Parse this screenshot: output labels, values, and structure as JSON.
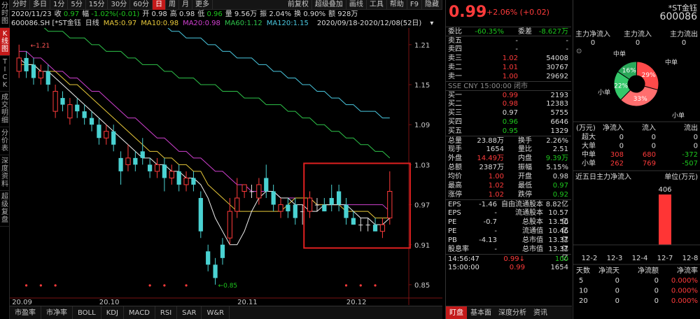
{
  "left_tabs": [
    "分时图",
    "K线图",
    "TICK",
    "成交明细",
    "分价表",
    "深度资料",
    "超级复盘"
  ],
  "toolbar": {
    "items": [
      "分时",
      "多日",
      "1分",
      "5分",
      "15分",
      "30分",
      "60分",
      "日",
      "周",
      "月",
      "更多"
    ],
    "active": "日",
    "right_items": [
      "前复权",
      "超级叠加",
      "画线",
      "工具",
      "帮助",
      "F9",
      "隐藏"
    ]
  },
  "infobar": {
    "date": "2020/11/23",
    "items": [
      {
        "label": "收",
        "value": "0.97",
        "color": "#1ec81e"
      },
      {
        "label": "幅",
        "value": "-1.02%(-0.01)",
        "color": "#1ec81e"
      },
      {
        "label": "开",
        "value": "0.98",
        "color": "#dcdcdc"
      },
      {
        "label": "高",
        "value": "0.98",
        "color": "#dcdcdc"
      },
      {
        "label": "低",
        "value": "0.96",
        "color": "#1ec81e"
      },
      {
        "label": "量",
        "value": "9.56万",
        "color": "#dcdcdc"
      },
      {
        "label": "振",
        "value": "2.04%",
        "color": "#dcdcdc"
      },
      {
        "label": "换",
        "value": "0.90%",
        "color": "#dcdcdc"
      },
      {
        "label": "额",
        "value": "928万",
        "color": "#dcdcdc"
      }
    ]
  },
  "mabar": {
    "symbol": "600086.SH [*ST金钰",
    "items": [
      {
        "text": "日线",
        "color": "#e0e0e0"
      },
      {
        "text": "MA5:0.97",
        "color": "#e8c93a"
      },
      {
        "text": "MA10:0.98",
        "color": "#e8c93a"
      },
      {
        "text": "MA20:0.98",
        "color": "#d040d0"
      },
      {
        "text": "MA60:1.12",
        "color": "#2ec44a"
      },
      {
        "text": "MA120:1.15",
        "color": "#4ac8e0"
      }
    ],
    "range": "2020/09/18-2020/12/08(52日)"
  },
  "chart_data": {
    "type": "candlestick",
    "y_ticks": [
      "1.21",
      "1.15",
      "1.09",
      "1.03",
      "0.97",
      "0.91",
      "0.85"
    ],
    "x_ticks": [
      "20.09",
      "20.10",
      "20.11",
      "20.12"
    ],
    "ylim": [
      0.83,
      1.235
    ],
    "high_label": "1.21",
    "low_label": "0.85",
    "candles": [
      {
        "o": 1.17,
        "c": 1.19,
        "h": 1.21,
        "l": 1.16
      },
      {
        "o": 1.19,
        "c": 1.17,
        "h": 1.2,
        "l": 1.16
      },
      {
        "o": 1.18,
        "c": 1.16,
        "h": 1.19,
        "l": 1.15
      },
      {
        "o": 1.16,
        "c": 1.17,
        "h": 1.18,
        "l": 1.15
      },
      {
        "o": 1.17,
        "c": 1.15,
        "h": 1.18,
        "l": 1.14
      },
      {
        "o": 1.11,
        "c": 1.14,
        "h": 1.15,
        "l": 1.1
      },
      {
        "o": 1.13,
        "c": 1.12,
        "h": 1.14,
        "l": 1.11
      },
      {
        "o": 1.1,
        "c": 1.12,
        "h": 1.13,
        "l": 1.09
      },
      {
        "o": 1.12,
        "c": 1.11,
        "h": 1.13,
        "l": 1.1
      },
      {
        "o": 1.11,
        "c": 1.1,
        "h": 1.12,
        "l": 1.09
      },
      {
        "o": 1.1,
        "c": 1.09,
        "h": 1.11,
        "l": 1.08
      },
      {
        "o": 1.09,
        "c": 1.07,
        "h": 1.1,
        "l": 1.06
      },
      {
        "o": 1.07,
        "c": 1.08,
        "h": 1.09,
        "l": 1.06
      },
      {
        "o": 1.08,
        "c": 1.06,
        "h": 1.09,
        "l": 1.05
      },
      {
        "o": 1.04,
        "c": 1.02,
        "h": 1.05,
        "l": 1.0
      },
      {
        "o": 1.03,
        "c": 1.04,
        "h": 1.06,
        "l": 1.02
      },
      {
        "o": 1.04,
        "c": 1.03,
        "h": 1.05,
        "l": 1.02
      },
      {
        "o": 1.05,
        "c": 1.04,
        "h": 1.07,
        "l": 1.03
      },
      {
        "o": 1.03,
        "c": 1.02,
        "h": 1.04,
        "l": 1.01
      },
      {
        "o": 1.02,
        "c": 1.03,
        "h": 1.04,
        "l": 1.01
      },
      {
        "o": 1.03,
        "c": 1.01,
        "h": 1.04,
        "l": 0.99
      },
      {
        "o": 1.01,
        "c": 1.02,
        "h": 1.03,
        "l": 1.0
      },
      {
        "o": 1.02,
        "c": 1.0,
        "h": 1.03,
        "l": 0.99
      },
      {
        "o": 1.0,
        "c": 1.01,
        "h": 1.02,
        "l": 0.99
      },
      {
        "o": 1.01,
        "c": 1.0,
        "h": 1.02,
        "l": 0.99
      },
      {
        "o": 0.98,
        "c": 0.93,
        "h": 0.99,
        "l": 0.92
      },
      {
        "o": 0.9,
        "c": 0.88,
        "h": 0.91,
        "l": 0.87
      },
      {
        "o": 0.88,
        "c": 0.86,
        "h": 0.89,
        "l": 0.85
      },
      {
        "o": 0.91,
        "c": 0.89,
        "h": 0.92,
        "l": 0.88
      },
      {
        "o": 0.92,
        "c": 0.96,
        "h": 0.98,
        "l": 0.91
      },
      {
        "o": 0.96,
        "c": 0.98,
        "h": 1.01,
        "l": 0.95
      },
      {
        "o": 0.99,
        "c": 1.0,
        "h": 1.0,
        "l": 0.98
      },
      {
        "o": 0.99,
        "c": 0.99,
        "h": 1.0,
        "l": 0.98
      },
      {
        "o": 0.98,
        "c": 1.0,
        "h": 1.01,
        "l": 0.97
      },
      {
        "o": 1.01,
        "c": 0.99,
        "h": 1.03,
        "l": 0.98
      },
      {
        "o": 0.99,
        "c": 0.97,
        "h": 1.0,
        "l": 0.96
      },
      {
        "o": 0.96,
        "c": 0.97,
        "h": 0.98,
        "l": 0.95
      },
      {
        "o": 0.97,
        "c": 0.96,
        "h": 0.98,
        "l": 0.95
      },
      {
        "o": 0.97,
        "c": 0.95,
        "h": 0.98,
        "l": 0.94
      },
      {
        "o": 0.96,
        "c": 0.96,
        "h": 0.97,
        "l": 0.94
      },
      {
        "o": 0.96,
        "c": 0.98,
        "h": 0.99,
        "l": 0.95
      },
      {
        "o": 0.97,
        "c": 0.97,
        "h": 0.98,
        "l": 0.96
      },
      {
        "o": 0.97,
        "c": 0.96,
        "h": 0.98,
        "l": 0.96
      },
      {
        "o": 0.98,
        "c": 0.97,
        "h": 1.0,
        "l": 0.96
      },
      {
        "o": 0.99,
        "c": 0.97,
        "h": 1.0,
        "l": 0.96
      },
      {
        "o": 0.97,
        "c": 0.95,
        "h": 0.98,
        "l": 0.94
      },
      {
        "o": 0.95,
        "c": 0.94,
        "h": 0.96,
        "l": 0.94
      },
      {
        "o": 0.94,
        "c": 0.94,
        "h": 0.95,
        "l": 0.93
      },
      {
        "o": 0.94,
        "c": 0.94,
        "h": 0.95,
        "l": 0.93
      },
      {
        "o": 0.94,
        "c": 0.93,
        "h": 0.95,
        "l": 0.93
      },
      {
        "o": 0.93,
        "c": 0.94,
        "h": 0.95,
        "l": 0.92
      },
      {
        "o": 0.95,
        "c": 0.99,
        "h": 1.02,
        "l": 0.94
      }
    ],
    "ma5": [
      1.19,
      1.18,
      1.18,
      1.17,
      1.17,
      1.16,
      1.15,
      1.14,
      1.13,
      1.12,
      1.11,
      1.1,
      1.09,
      1.08,
      1.07,
      1.06,
      1.05,
      1.04,
      1.04,
      1.03,
      1.03,
      1.02,
      1.02,
      1.01,
      1.01,
      1.0,
      0.98,
      0.95,
      0.93,
      0.91,
      0.91,
      0.93,
      0.96,
      0.98,
      0.99,
      0.99,
      0.98,
      0.98,
      0.97,
      0.97,
      0.96,
      0.96,
      0.97,
      0.97,
      0.97,
      0.97,
      0.96,
      0.95,
      0.95,
      0.94,
      0.94,
      0.95
    ],
    "ma10": [
      1.18,
      1.18,
      1.18,
      1.17,
      1.17,
      1.17,
      1.16,
      1.15,
      1.15,
      1.14,
      1.13,
      1.12,
      1.11,
      1.1,
      1.09,
      1.08,
      1.07,
      1.06,
      1.05,
      1.05,
      1.04,
      1.04,
      1.03,
      1.03,
      1.02,
      1.02,
      1.0,
      0.99,
      0.98,
      0.97,
      0.96,
      0.96,
      0.96,
      0.96,
      0.96,
      0.96,
      0.96,
      0.97,
      0.98,
      0.98,
      0.98,
      0.97,
      0.97,
      0.97,
      0.97,
      0.96,
      0.96,
      0.96,
      0.96,
      0.95,
      0.95,
      0.95
    ],
    "ma20": [
      1.2,
      1.2,
      1.19,
      1.19,
      1.18,
      1.17,
      1.17,
      1.16,
      1.16,
      1.15,
      1.14,
      1.14,
      1.13,
      1.12,
      1.11,
      1.1,
      1.1,
      1.09,
      1.08,
      1.07,
      1.07,
      1.06,
      1.05,
      1.05,
      1.04,
      1.04,
      1.03,
      1.02,
      1.02,
      1.01,
      1.0,
      1.0,
      0.99,
      0.99,
      0.99,
      0.99,
      0.98,
      0.98,
      0.98,
      0.98,
      0.98,
      0.97,
      0.97,
      0.97,
      0.97,
      0.97,
      0.97,
      0.97,
      0.97,
      0.97,
      0.97,
      0.96
    ],
    "ma60": [
      1.24,
      1.24,
      1.24,
      1.24,
      1.23,
      1.23,
      1.23,
      1.22,
      1.22,
      1.22,
      1.21,
      1.21,
      1.2,
      1.2,
      1.2,
      1.19,
      1.19,
      1.18,
      1.18,
      1.18,
      1.17,
      1.17,
      1.16,
      1.16,
      1.16,
      1.15,
      1.15,
      1.15,
      1.14,
      1.14,
      1.14,
      1.13,
      1.13,
      1.13,
      1.12,
      1.12,
      1.12,
      1.11,
      1.11,
      1.1,
      1.1,
      1.09,
      1.09,
      1.08,
      1.08,
      1.07,
      1.07,
      1.06,
      1.06,
      1.05,
      1.05,
      1.04
    ],
    "ma120": [
      1.3,
      1.3,
      1.3,
      1.29,
      1.29,
      1.29,
      1.28,
      1.28,
      1.28,
      1.27,
      1.27,
      1.27,
      1.26,
      1.26,
      1.26,
      1.25,
      1.25,
      1.25,
      1.24,
      1.24,
      1.24,
      1.23,
      1.23,
      1.22,
      1.22,
      1.22,
      1.21,
      1.21,
      1.2,
      1.2,
      1.19,
      1.19,
      1.19,
      1.18,
      1.18,
      1.17,
      1.17,
      1.16,
      1.16,
      1.15,
      1.15,
      1.14,
      1.14,
      1.13,
      1.13,
      1.12,
      1.12,
      1.11,
      1.11,
      1.11,
      1.1,
      1.1
    ],
    "markers": [
      1,
      3,
      5,
      18,
      20,
      23,
      45,
      47,
      49
    ]
  },
  "bottom_tabs": [
    "市盈率",
    "市净率",
    "BOLL",
    "KDJ",
    "MACD",
    "RSI",
    "SAR",
    "W&R"
  ],
  "quote": {
    "price": "0.99",
    "change": "+2.06% (+0.02)",
    "name": "*ST金钰",
    "code": "600086",
    "webi": {
      "label": "委比",
      "value": "-60.35%"
    },
    "weicha": {
      "label": "委差",
      "value": "-8.627万"
    },
    "sells": [
      {
        "label": "卖五",
        "price": "-",
        "vol": "-"
      },
      {
        "label": "卖四",
        "price": "-",
        "vol": "-"
      },
      {
        "label": "卖三",
        "price": "1.02",
        "vol": "54008"
      },
      {
        "label": "卖二",
        "price": "1.01",
        "vol": "30767"
      },
      {
        "label": "卖一",
        "price": "1.00",
        "vol": "29692"
      }
    ],
    "exchange": "SSE CNY 15:00:00 闭市",
    "buys": [
      {
        "label": "买一",
        "price": "0.99",
        "vol": "2193",
        "color": "#ff3b3b"
      },
      {
        "label": "买二",
        "price": "0.98",
        "vol": "12383",
        "color": "#ff3b3b"
      },
      {
        "label": "买三",
        "price": "0.97",
        "vol": "5755",
        "color": "#dcdcdc"
      },
      {
        "label": "买四",
        "price": "0.96",
        "vol": "6646",
        "color": "#1ec81e"
      },
      {
        "label": "买五",
        "price": "0.95",
        "vol": "1329",
        "color": "#1ec81e"
      }
    ],
    "stats": [
      {
        "l1": "总量",
        "v1": "23.88万",
        "c1": "#dcdcdc",
        "l2": "换手",
        "v2": "2.26%",
        "c2": "#dcdcdc"
      },
      {
        "l1": "现手",
        "v1": "1654",
        "c1": "#dcdcdc",
        "l2": "量比",
        "v2": "2.51",
        "c2": "#dcdcdc"
      },
      {
        "l1": "外盘",
        "v1": "14.49万",
        "c1": "#ff3b3b",
        "l2": "内盘",
        "v2": "9.39万",
        "c2": "#1ec81e"
      },
      {
        "l1": "总额",
        "v1": "2387万",
        "c1": "#dcdcdc",
        "l2": "振幅",
        "v2": "5.15%",
        "c2": "#dcdcdc"
      },
      {
        "l1": "均价",
        "v1": "1.00",
        "c1": "#ff3b3b",
        "l2": "开盘",
        "v2": "0.98",
        "c2": "#dcdcdc"
      },
      {
        "l1": "最高",
        "v1": "1.02",
        "c1": "#ff3b3b",
        "l2": "最低",
        "v2": "0.97",
        "c2": "#1ec81e"
      },
      {
        "l1": "涨停",
        "v1": "1.02",
        "c1": "#ff3b3b",
        "l2": "跌停",
        "v2": "0.92",
        "c2": "#1ec81e"
      }
    ],
    "fundamentals": [
      {
        "l1": "EPS",
        "v1": "-1.46",
        "l2": "自由流通股本",
        "v2": "8.82亿"
      },
      {
        "l1": "EPS",
        "v1": "-",
        "l2": "流通股本",
        "v2": "10.57亿"
      },
      {
        "l1": "PE",
        "v1": "-0.7",
        "l2": "总股本",
        "v2": "13.50亿"
      },
      {
        "l1": "PE",
        "v1": "-",
        "l2": "流通值",
        "v2": "10.46亿"
      },
      {
        "l1": "PB",
        "v1": "-4.13",
        "l2": "总市值",
        "v2": "13.37亿"
      },
      {
        "l1": "股息率",
        "v1": "-",
        "l2": "总市值",
        "v2": "13.37亿"
      }
    ],
    "ticks": [
      {
        "time": "14:56:47",
        "price": "0.99",
        "vol": "100",
        "vcolor": "#1ec81e",
        "arrow": "↓"
      },
      {
        "time": "15:00:00",
        "price": "0.99",
        "vol": "1654",
        "vcolor": "#dcdcdc",
        "arrow": ""
      }
    ],
    "tabs": [
      "盯盘",
      "基本面",
      "深度分析",
      "资讯"
    ]
  },
  "flow": {
    "name": "*ST金钰",
    "code": "600086",
    "headers": [
      "主力净流入",
      "主力流入",
      "主力流出"
    ],
    "values": [
      "0",
      "0",
      "0"
    ],
    "pie": {
      "slices": [
        {
          "label": "中单",
          "pct": 29,
          "text": "29%",
          "color": "#ff4a4a"
        },
        {
          "label": "小单",
          "pct": 33,
          "text": "33%",
          "color": "#ff6e6e"
        },
        {
          "label": "小单",
          "pct": 22,
          "text": "22%",
          "color": "#34c86a"
        },
        {
          "label": "中单",
          "pct": 16,
          "text": "16%",
          "color": "#2aa85a"
        }
      ]
    },
    "table_headers": [
      "(万元)",
      "净流入",
      "流入",
      "流出"
    ],
    "table_rows": [
      {
        "name": "超大",
        "net": "0",
        "in": "0",
        "out": "0",
        "ncolor": "#dcdcdc",
        "icolor": "#dcdcdc",
        "ocolor": "#dcdcdc"
      },
      {
        "name": "大单",
        "net": "0",
        "in": "0",
        "out": "0",
        "ncolor": "#dcdcdc",
        "icolor": "#dcdcdc",
        "ocolor": "#dcdcdc"
      },
      {
        "name": "中单",
        "net": "308",
        "in": "680",
        "out": "-372",
        "ncolor": "#ff3b3b",
        "icolor": "#ff3b3b",
        "ocolor": "#1ec81e"
      },
      {
        "name": "小单",
        "net": "262",
        "in": "769",
        "out": "-507",
        "ncolor": "#ff3b3b",
        "icolor": "#ff3b3b",
        "ocolor": "#1ec81e"
      }
    ],
    "five_day_title": "近五日主力净流入",
    "five_day_unit": "单位(万元)",
    "five_day": {
      "categories": [
        "12-2",
        "12-3",
        "12-4",
        "12-7",
        "12-8"
      ],
      "values": [
        0,
        0,
        0,
        406,
        0
      ],
      "labels": [
        "",
        "",
        "",
        "406",
        ""
      ]
    },
    "day_headers": [
      "天数",
      "净流天",
      "净流额",
      "净流率"
    ],
    "day_rows": [
      {
        "d": "5",
        "a": "0",
        "b": "0",
        "c": "0.000%"
      },
      {
        "d": "10",
        "a": "0",
        "b": "0",
        "c": "0.000%"
      },
      {
        "d": "20",
        "a": "0",
        "b": "0",
        "c": "0.000%"
      }
    ]
  }
}
